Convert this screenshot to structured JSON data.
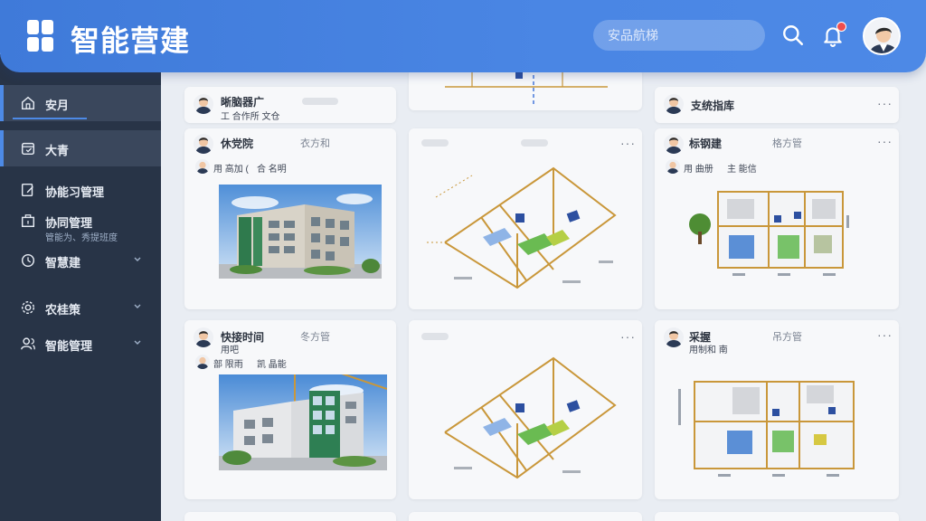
{
  "app": {
    "title": "智能营建"
  },
  "header": {
    "search_placeholder": "安品航梯",
    "search_icon": "search-icon",
    "bell_icon": "bell-icon",
    "avatar": "user-avatar",
    "accent_color": "#4a86e4"
  },
  "sidebar": {
    "items": [
      {
        "label": "安月",
        "icon": "home-icon",
        "active": true,
        "sub": ""
      },
      {
        "label": "大青",
        "icon": "calendar-icon",
        "active": false,
        "sub": ""
      },
      {
        "label": "协能习管理",
        "icon": "edit-icon",
        "active": false,
        "sub": ""
      },
      {
        "label": "协同管理",
        "icon": "building-icon",
        "active": false,
        "sub": "管能为、秀提班度"
      },
      {
        "label": "智慧建",
        "icon": "clock-icon",
        "active": false,
        "sub": ""
      },
      {
        "label": "农桂策",
        "icon": "gear-icon",
        "active": false,
        "sub": ""
      },
      {
        "label": "智能管理",
        "icon": "user-icon",
        "active": false,
        "sub": ""
      }
    ]
  },
  "feed": {
    "top_row": [
      {
        "name": "晰脑器广",
        "sub": "工 合作所 文仓"
      },
      {
        "name": ""
      },
      {
        "name": "支统指库",
        "more": "···"
      }
    ],
    "cards": [
      {
        "name": "休党院",
        "meta": "衣方和",
        "reply_name": "用 高加 (",
        "reply_meta": "合 名明",
        "type": "photo"
      },
      {
        "name": "",
        "type": "plan3d",
        "more": "···"
      },
      {
        "name": "标钢建",
        "meta": "格方管",
        "reply_name": "用 曲册",
        "reply_meta": "主 能信",
        "type": "plan2d",
        "more": "···"
      },
      {
        "name": "快接时间",
        "meta": "冬方管",
        "reply_name": "部 限雨",
        "reply_meta": "凯 晶能",
        "sub": "用吧",
        "type": "photo",
        "more": ""
      },
      {
        "name": "",
        "type": "plan3d",
        "more": "···"
      },
      {
        "name": "采握",
        "meta": "吊方管",
        "reply_name": "用制和 南",
        "type": "plan2d",
        "more": "···"
      }
    ]
  }
}
